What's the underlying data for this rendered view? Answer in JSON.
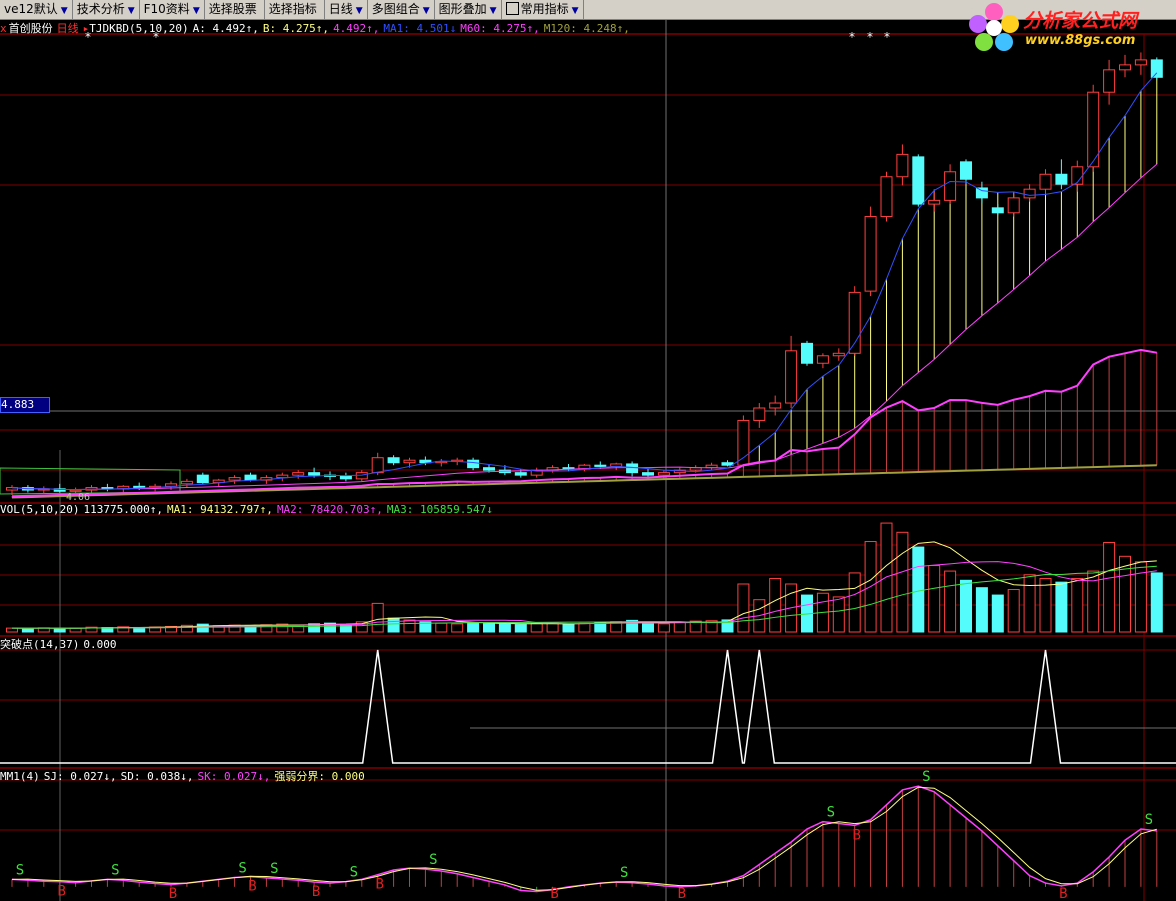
{
  "toolbar": {
    "items": [
      {
        "label": "ve12默认",
        "arrow": "▼"
      },
      {
        "label": "技术分析",
        "arrow": "▼"
      },
      {
        "label": "F10资料",
        "arrow": "▼"
      },
      {
        "label": "选择股票",
        "arrow": ""
      },
      {
        "label": "选择指标",
        "arrow": ""
      },
      {
        "label": "日线",
        "arrow": "▼"
      },
      {
        "label": "多图组合",
        "arrow": "▼"
      },
      {
        "label": "图形叠加",
        "arrow": "▼"
      },
      {
        "label": "常用指标",
        "arrow": "▼"
      }
    ],
    "arrow_glyph": "▼"
  },
  "logo": {
    "title": "分析家公式网",
    "url": "www.88gs.com"
  },
  "main_header": {
    "close_glyph": "x",
    "stock_name": "首创股份",
    "period": "日线",
    "indicator": "TJDKBD(5,10,20)",
    "A": "A: 4.492↑,",
    "B": "B: 4.275↑,",
    "C": "4.492↑,",
    "MA1": "MA1: 4.501↓",
    "M60": "M60: 4.275↑,",
    "M120": "M120: 4.248↑,"
  },
  "price_label": "4.883",
  "low_label": "4.06",
  "star_glyph": "*",
  "vol_header": {
    "name": "VOL(5,10,20)",
    "value": "113775.000↑,",
    "MA1": "MA1: 94132.797↑,",
    "MA2": "MA2: 78420.703↑,",
    "MA3": "MA3: 105859.547↓"
  },
  "brk_header": {
    "name": "突破点(14,37)",
    "value": "0.000"
  },
  "mm_header": {
    "name": "MM1(4)",
    "SJ": "SJ: 0.027↓,",
    "SD": "SD: 0.038↓,",
    "SK": "SK: 0.027↓,",
    "boundary": "强弱分界: 0.000"
  },
  "signals": {
    "buy": "B",
    "sell": "S"
  },
  "colors": {
    "up": "#ff4040",
    "down": "#54fcfc",
    "ma_blue": "#3050ff",
    "ma_magenta": "#ff40ff",
    "ma_olive": "#a0a040",
    "yellow": "#ffff80",
    "green": "#40c040",
    "grid": "#800000"
  },
  "chart_data": {
    "type": "candlestick",
    "ohlc": [
      [
        4.1,
        4.14,
        4.06,
        4.12
      ],
      [
        4.12,
        4.14,
        4.08,
        4.1
      ],
      [
        4.1,
        4.13,
        4.07,
        4.11
      ],
      [
        4.11,
        4.15,
        4.08,
        4.09
      ],
      [
        4.09,
        4.12,
        4.06,
        4.1
      ],
      [
        4.1,
        4.14,
        4.08,
        4.12
      ],
      [
        4.12,
        4.15,
        4.09,
        4.11
      ],
      [
        4.11,
        4.14,
        4.08,
        4.13
      ],
      [
        4.13,
        4.16,
        4.1,
        4.12
      ],
      [
        4.12,
        4.15,
        4.09,
        4.13
      ],
      [
        4.13,
        4.17,
        4.1,
        4.15
      ],
      [
        4.15,
        4.19,
        4.12,
        4.17
      ],
      [
        4.22,
        4.24,
        4.15,
        4.16
      ],
      [
        4.16,
        4.19,
        4.13,
        4.18
      ],
      [
        4.18,
        4.22,
        4.15,
        4.2
      ],
      [
        4.22,
        4.24,
        4.17,
        4.18
      ],
      [
        4.18,
        4.22,
        4.15,
        4.2
      ],
      [
        4.2,
        4.24,
        4.17,
        4.22
      ],
      [
        4.22,
        4.26,
        4.19,
        4.24
      ],
      [
        4.24,
        4.28,
        4.2,
        4.22
      ],
      [
        4.22,
        4.25,
        4.18,
        4.21
      ],
      [
        4.21,
        4.24,
        4.17,
        4.19
      ],
      [
        4.19,
        4.26,
        4.17,
        4.24
      ],
      [
        4.24,
        4.4,
        4.22,
        4.36
      ],
      [
        4.36,
        4.38,
        4.3,
        4.32
      ],
      [
        4.32,
        4.36,
        4.28,
        4.34
      ],
      [
        4.34,
        4.37,
        4.3,
        4.32
      ],
      [
        4.32,
        4.35,
        4.29,
        4.33
      ],
      [
        4.33,
        4.36,
        4.3,
        4.34
      ],
      [
        4.34,
        4.36,
        4.26,
        4.28
      ],
      [
        4.28,
        4.31,
        4.24,
        4.26
      ],
      [
        4.26,
        4.3,
        4.22,
        4.24
      ],
      [
        4.24,
        4.27,
        4.2,
        4.22
      ],
      [
        4.22,
        4.28,
        4.2,
        4.26
      ],
      [
        4.26,
        4.3,
        4.24,
        4.28
      ],
      [
        4.28,
        4.31,
        4.25,
        4.27
      ],
      [
        4.27,
        4.31,
        4.25,
        4.3
      ],
      [
        4.3,
        4.33,
        4.27,
        4.29
      ],
      [
        4.29,
        4.32,
        4.26,
        4.31
      ],
      [
        4.31,
        4.33,
        4.21,
        4.24
      ],
      [
        4.24,
        4.27,
        4.2,
        4.22
      ],
      [
        4.22,
        4.26,
        4.2,
        4.24
      ],
      [
        4.24,
        4.28,
        4.22,
        4.26
      ],
      [
        4.26,
        4.3,
        4.24,
        4.28
      ],
      [
        4.28,
        4.32,
        4.26,
        4.3
      ],
      [
        4.32,
        4.34,
        4.29,
        4.3
      ],
      [
        4.3,
        4.7,
        4.28,
        4.66
      ],
      [
        4.66,
        4.8,
        4.6,
        4.76
      ],
      [
        4.76,
        4.86,
        4.7,
        4.8
      ],
      [
        4.8,
        5.34,
        4.76,
        5.22
      ],
      [
        5.28,
        5.3,
        5.1,
        5.12
      ],
      [
        5.12,
        5.2,
        5.08,
        5.18
      ],
      [
        5.18,
        5.24,
        5.14,
        5.2
      ],
      [
        5.2,
        5.74,
        5.18,
        5.69
      ],
      [
        5.7,
        6.38,
        5.66,
        6.3
      ],
      [
        6.3,
        6.66,
        6.26,
        6.62
      ],
      [
        6.62,
        6.88,
        6.55,
        6.8
      ],
      [
        6.78,
        6.8,
        6.38,
        6.4
      ],
      [
        6.4,
        6.52,
        6.34,
        6.43
      ],
      [
        6.43,
        6.72,
        6.4,
        6.66
      ],
      [
        6.74,
        6.76,
        6.56,
        6.6
      ],
      [
        6.53,
        6.58,
        6.41,
        6.45
      ],
      [
        6.37,
        6.4,
        6.31,
        6.33
      ],
      [
        6.33,
        6.5,
        6.3,
        6.45
      ],
      [
        6.45,
        6.56,
        6.42,
        6.52
      ],
      [
        6.52,
        6.68,
        6.48,
        6.64
      ],
      [
        6.64,
        6.76,
        6.52,
        6.56
      ],
      [
        6.56,
        6.75,
        6.5,
        6.7
      ],
      [
        6.7,
        7.36,
        6.66,
        7.3
      ],
      [
        7.3,
        7.56,
        7.2,
        7.48
      ],
      [
        7.48,
        7.6,
        7.42,
        7.52
      ],
      [
        7.52,
        7.62,
        7.44,
        7.56
      ],
      [
        7.56,
        7.58,
        7.4,
        7.42
      ]
    ],
    "volume": [
      4200,
      3800,
      4500,
      3900,
      4100,
      5200,
      4800,
      5600,
      4900,
      5300,
      6000,
      7200,
      8500,
      6800,
      7400,
      6900,
      7800,
      8600,
      7200,
      8900,
      9600,
      8200,
      11000,
      31000,
      15000,
      13000,
      11000,
      9500,
      8800,
      10200,
      9000,
      8500,
      8000,
      9200,
      9800,
      8700,
      9400,
      10500,
      11200,
      12600,
      9800,
      8900,
      10400,
      11800,
      12200,
      13100,
      52000,
      35000,
      58000,
      52000,
      40000,
      42000,
      38000,
      64000,
      98000,
      118000,
      108000,
      92000,
      72000,
      66000,
      56000,
      48000,
      40000,
      46000,
      62000,
      58000,
      54000,
      58000,
      66000,
      97000,
      82000,
      76000,
      64000
    ],
    "breakout": [
      0,
      0,
      0,
      0,
      0,
      0,
      0,
      0,
      0,
      0,
      0,
      0,
      0,
      0,
      0,
      0,
      0,
      0,
      0,
      0,
      0,
      0,
      0,
      1,
      0,
      0,
      0,
      0,
      0,
      0,
      0,
      0,
      0,
      0,
      0,
      0,
      0,
      0,
      0,
      0,
      0,
      0,
      0,
      0,
      0,
      1,
      0,
      1,
      0,
      0,
      0,
      0,
      0,
      0,
      0,
      0,
      0,
      0,
      0,
      0,
      0,
      0,
      0,
      0,
      0,
      1,
      0,
      0,
      0,
      0,
      0,
      0,
      0
    ],
    "mm_curve": [
      0.04,
      0.035,
      0.03,
      0.028,
      0.022,
      0.032,
      0.04,
      0.035,
      0.025,
      0.018,
      0.012,
      0.02,
      0.03,
      0.04,
      0.05,
      0.055,
      0.048,
      0.042,
      0.035,
      0.026,
      0.02,
      0.028,
      0.04,
      0.065,
      0.09,
      0.1,
      0.095,
      0.085,
      0.07,
      0.05,
      0.03,
      0.01,
      -0.02,
      -0.025,
      -0.015,
      0.0,
      0.01,
      0.02,
      0.025,
      0.022,
      0.015,
      0.005,
      0.0,
      0.005,
      0.015,
      0.03,
      0.06,
      0.12,
      0.18,
      0.24,
      0.31,
      0.35,
      0.34,
      0.33,
      0.36,
      0.44,
      0.52,
      0.54,
      0.51,
      0.44,
      0.37,
      0.3,
      0.22,
      0.14,
      0.06,
      0.02,
      0.005,
      0.02,
      0.08,
      0.16,
      0.25,
      0.31,
      0.3
    ],
    "y_range_price": [
      4.02,
      7.72
    ],
    "y_range_volume": [
      0,
      130000
    ],
    "y_range_mm": [
      -0.06,
      0.6
    ]
  }
}
